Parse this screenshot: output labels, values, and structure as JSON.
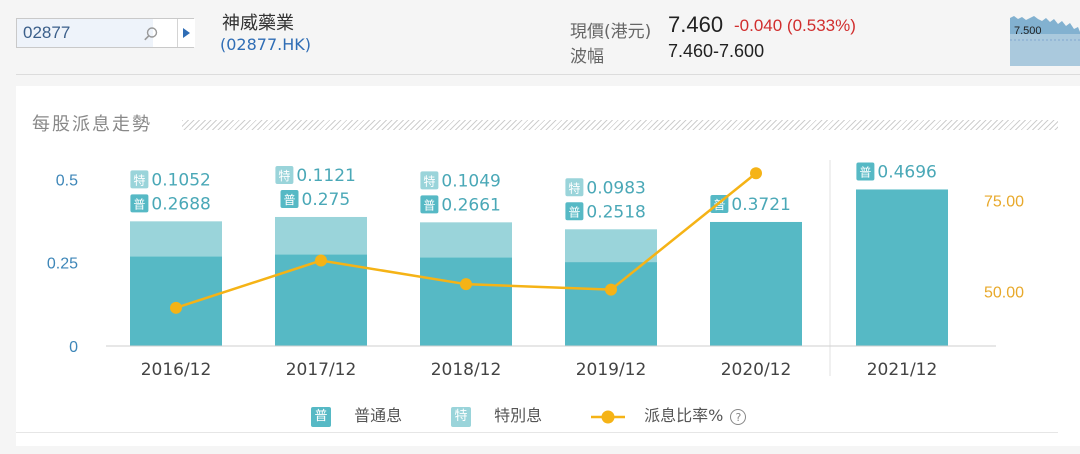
{
  "header": {
    "search_value": "02877",
    "stock_name": "神威藥業",
    "stock_code": "(02877.HK)",
    "price_label": "現價(港元)",
    "price": "7.460",
    "change": "-0.040 (0.533%)",
    "range_label": "波幅",
    "range": "7.460-7.600",
    "spark_label": "7.500"
  },
  "card": {
    "title": "每股派息走勢"
  },
  "legend": {
    "regular_badge": "普",
    "regular_label": "普通息",
    "special_badge": "特",
    "special_label": "特別息",
    "ratio_label": "派息比率%",
    "help": "?"
  },
  "colors": {
    "regular": "#56b9c5",
    "special": "#9ad4da",
    "ratio": "#f5b316",
    "up_text": "#d12e2e",
    "link": "#2f6db5"
  },
  "chart_data": {
    "type": "bar",
    "categories": [
      "2016/12",
      "2017/12",
      "2018/12",
      "2019/12",
      "2020/12",
      "2021/12"
    ],
    "series": [
      {
        "name": "普通息",
        "values": [
          0.2688,
          0.275,
          0.2661,
          0.2518,
          0.3721,
          0.4696
        ],
        "labels": [
          "0.2688",
          "0.275",
          "0.2661",
          "0.2518",
          "0.3721",
          "0.4696"
        ]
      },
      {
        "name": "特別息",
        "values": [
          0.1052,
          0.1121,
          0.1049,
          0.0983,
          null,
          null
        ],
        "labels": [
          "0.1052",
          "0.1121",
          "0.1049",
          "0.0983",
          "",
          ""
        ]
      },
      {
        "name": "派息比率%",
        "axis": "right",
        "values": [
          45.5,
          58.5,
          52,
          50.5,
          82.5,
          null
        ]
      }
    ],
    "y_left": {
      "ticks": [
        "0",
        "0.25",
        "0.5"
      ],
      "tick_values": [
        0,
        0.25,
        0.5
      ],
      "ylim": [
        0,
        0.6
      ]
    },
    "y_right": {
      "ticks": [
        "50.00",
        "75.00"
      ],
      "tick_values": [
        50,
        75
      ],
      "ylim": [
        35,
        90
      ]
    },
    "stacked": true,
    "forecast_separator_after": "2020/12"
  }
}
